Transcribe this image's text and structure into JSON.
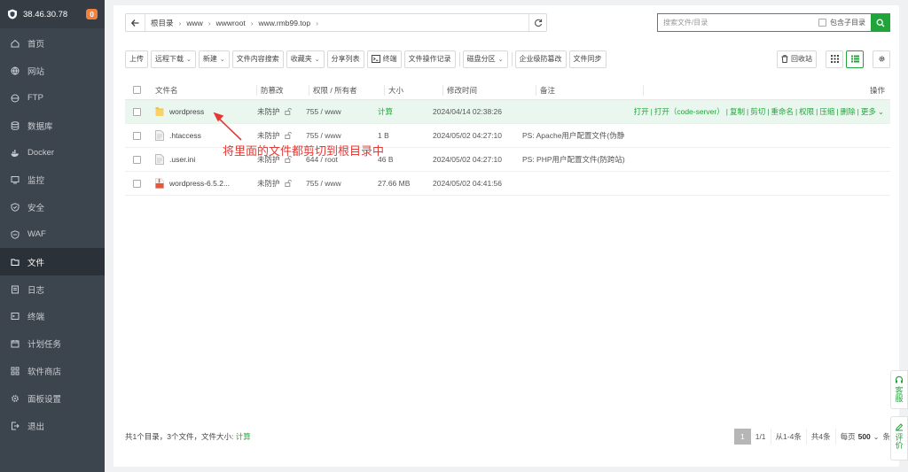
{
  "sidebar": {
    "server_ip": "38.46.30.78",
    "badge_count": "0",
    "items": [
      {
        "label": "首页",
        "icon": "home-icon"
      },
      {
        "label": "网站",
        "icon": "globe-icon"
      },
      {
        "label": "FTP",
        "icon": "ftp-icon"
      },
      {
        "label": "数据库",
        "icon": "database-icon"
      },
      {
        "label": "Docker",
        "icon": "docker-icon"
      },
      {
        "label": "监控",
        "icon": "monitor-icon"
      },
      {
        "label": "安全",
        "icon": "shield-icon"
      },
      {
        "label": "WAF",
        "icon": "waf-icon"
      },
      {
        "label": "文件",
        "icon": "folder-icon"
      },
      {
        "label": "日志",
        "icon": "log-icon"
      },
      {
        "label": "终端",
        "icon": "terminal-icon"
      },
      {
        "label": "计划任务",
        "icon": "calendar-icon"
      },
      {
        "label": "软件商店",
        "icon": "apps-icon"
      },
      {
        "label": "面板设置",
        "icon": "gear-icon"
      },
      {
        "label": "退出",
        "icon": "logout-icon"
      }
    ],
    "active_index": 8
  },
  "breadcrumb": [
    "根目录",
    "www",
    "wwwroot",
    "www.rmb99.top"
  ],
  "search": {
    "placeholder": "搜索文件/目录",
    "subdir_label": "包含子目录"
  },
  "toolbar": {
    "upload": "上传",
    "remote_download": "远程下载",
    "new": "新建",
    "content_search": "文件内容搜索",
    "favorites": "收藏夹",
    "share_list": "分享列表",
    "terminal": "终端",
    "op_log": "文件操作记录",
    "disk": "磁盘分区",
    "tamper": "企业级防篡改",
    "sync": "文件同步",
    "recycle": "回收站"
  },
  "table": {
    "headers": {
      "name": "文件名",
      "protect": "防篡改",
      "perm": "权限 / 所有者",
      "size": "大小",
      "mtime": "修改时间",
      "note": "备注",
      "action": "操作"
    },
    "rows": [
      {
        "name": "wordpress",
        "type": "folder",
        "protect": "未防护",
        "perm": "755 / www",
        "size": "计算",
        "mtime": "2024/04/14 02:38:26",
        "note": ""
      },
      {
        "name": ".htaccess",
        "type": "file",
        "protect": "未防护",
        "perm": "755 / www",
        "size": "1 B",
        "mtime": "2024/05/02 04:27:10",
        "note": "PS: Apache用户配置文件(伪静"
      },
      {
        "name": ".user.ini",
        "type": "file",
        "protect": "未防护",
        "perm": "644 / root",
        "size": "46 B",
        "mtime": "2024/05/02 04:27:10",
        "note": "PS: PHP用户配置文件(防跨站)"
      },
      {
        "name": "wordpress-6.5.2...",
        "type": "archive",
        "protect": "未防护",
        "perm": "755 / www",
        "size": "27.66 MB",
        "mtime": "2024/05/02 04:41:56",
        "note": ""
      }
    ],
    "row_actions": [
      "打开",
      "打开（code-server）",
      "复制",
      "剪切",
      "重命名",
      "权限",
      "压缩",
      "删除",
      "更多"
    ]
  },
  "annotation": "将里面的文件都剪切到根目录中",
  "footer": {
    "summary": "共1个目录，3个文件，文件大小:",
    "size_link": "计算",
    "page_current": "1",
    "page_total": "1/1",
    "range": "从1-4条",
    "total": "共4条",
    "per_page_label": "每页",
    "per_page_value": "500",
    "per_page_unit": "条"
  },
  "float_panel": {
    "service": "客服",
    "review": "评价"
  },
  "colors": {
    "accent": "#20a53a",
    "sidebar_bg": "#3c444d",
    "badge": "#f0803c",
    "annotation": "#e53935"
  }
}
